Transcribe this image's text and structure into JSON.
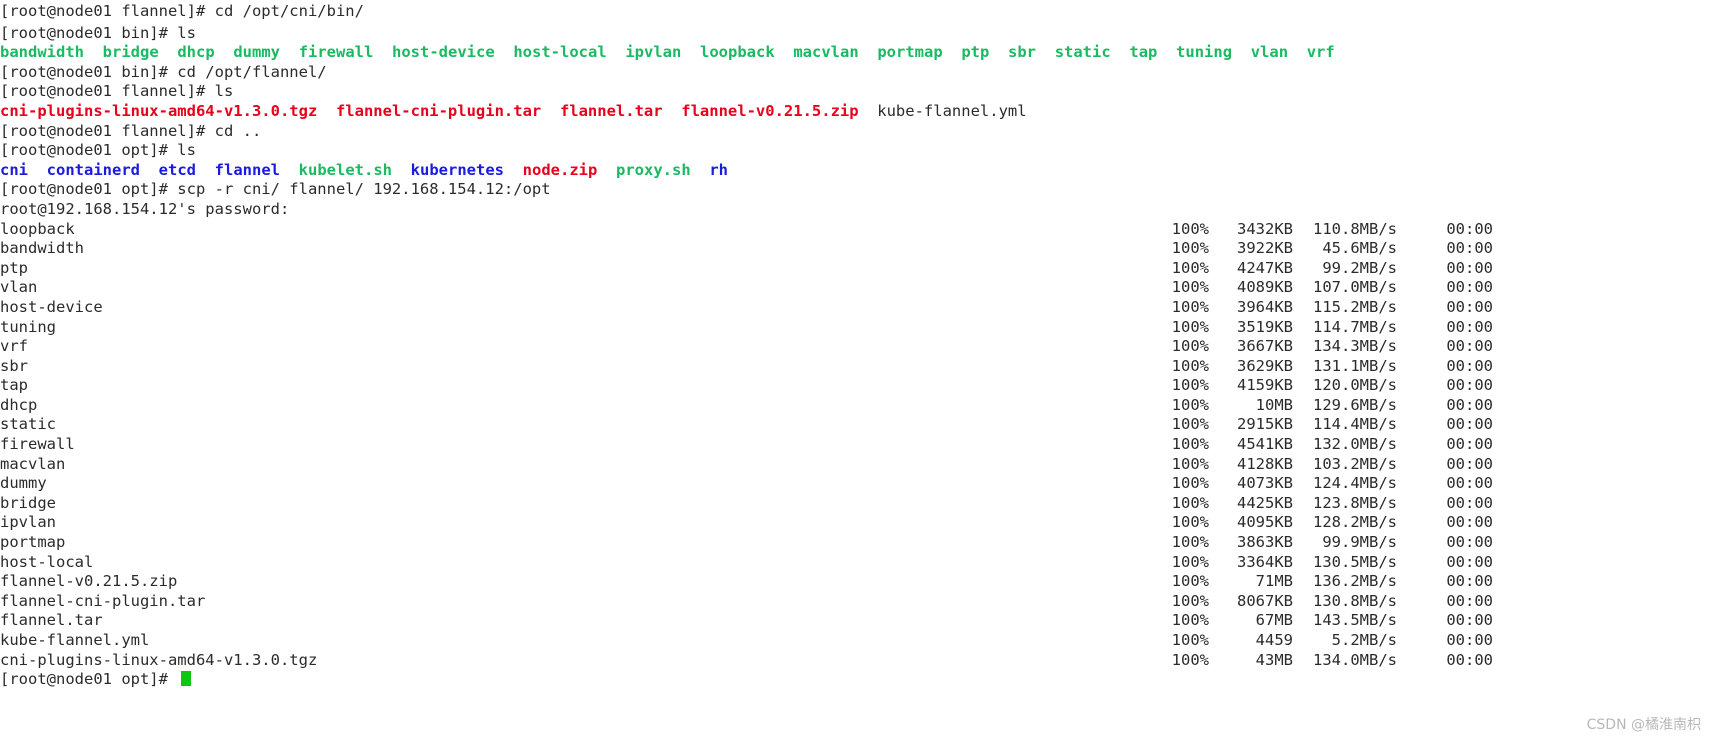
{
  "terminal": {
    "colors": {
      "background": "#ffffff",
      "default_text": "#2b2b2b",
      "directory_blue": "#1a1ae0",
      "executable_green": "#1aba61",
      "archive_red": "#e8001c",
      "cursor_green": "#12c512"
    },
    "prompts": {
      "p1": "[root@node01 flannel]# cd /opt/cni/bin/",
      "p2": "[root@node01 bin]# ls",
      "p3": "[root@node01 bin]# cd /opt/flannel/",
      "p4": "[root@node01 flannel]# ls",
      "p5": "[root@node01 flannel]# cd ..",
      "p6": "[root@node01 opt]# ls",
      "p7": "[root@node01 opt]# scp -r cni/ flannel/ 192.168.154.12:/opt",
      "p8": "root@192.168.154.12's password:",
      "p9": "[root@node01 opt]# "
    },
    "cni_bin_listing": [
      "bandwidth",
      "bridge",
      "dhcp",
      "dummy",
      "firewall",
      "host-device",
      "host-local",
      "ipvlan",
      "loopback",
      "macvlan",
      "portmap",
      "ptp",
      "sbr",
      "static",
      "tap",
      "tuning",
      "vlan",
      "vrf"
    ],
    "flannel_listing": [
      {
        "name": "cni-plugins-linux-amd64-v1.3.0.tgz",
        "color": "archive_red"
      },
      {
        "name": "flannel-cni-plugin.tar",
        "color": "archive_red"
      },
      {
        "name": "flannel.tar",
        "color": "archive_red"
      },
      {
        "name": "flannel-v0.21.5.zip",
        "color": "archive_red"
      },
      {
        "name": "kube-flannel.yml",
        "color": "default_text"
      }
    ],
    "opt_listing": [
      {
        "name": "cni",
        "color": "directory_blue"
      },
      {
        "name": "containerd",
        "color": "directory_blue"
      },
      {
        "name": "etcd",
        "color": "directory_blue"
      },
      {
        "name": "flannel",
        "color": "directory_blue"
      },
      {
        "name": "kubelet.sh",
        "color": "executable_green"
      },
      {
        "name": "kubernetes",
        "color": "directory_blue"
      },
      {
        "name": "node.zip",
        "color": "archive_red"
      },
      {
        "name": "proxy.sh",
        "color": "executable_green"
      },
      {
        "name": "rh",
        "color": "directory_blue"
      }
    ],
    "transfers": [
      {
        "name": "loopback",
        "percent": "100%",
        "size": "3432KB",
        "speed": "110.8MB/s",
        "time": "00:00"
      },
      {
        "name": "bandwidth",
        "percent": "100%",
        "size": "3922KB",
        "speed": "45.6MB/s",
        "time": "00:00"
      },
      {
        "name": "ptp",
        "percent": "100%",
        "size": "4247KB",
        "speed": "99.2MB/s",
        "time": "00:00"
      },
      {
        "name": "vlan",
        "percent": "100%",
        "size": "4089KB",
        "speed": "107.0MB/s",
        "time": "00:00"
      },
      {
        "name": "host-device",
        "percent": "100%",
        "size": "3964KB",
        "speed": "115.2MB/s",
        "time": "00:00"
      },
      {
        "name": "tuning",
        "percent": "100%",
        "size": "3519KB",
        "speed": "114.7MB/s",
        "time": "00:00"
      },
      {
        "name": "vrf",
        "percent": "100%",
        "size": "3667KB",
        "speed": "134.3MB/s",
        "time": "00:00"
      },
      {
        "name": "sbr",
        "percent": "100%",
        "size": "3629KB",
        "speed": "131.1MB/s",
        "time": "00:00"
      },
      {
        "name": "tap",
        "percent": "100%",
        "size": "4159KB",
        "speed": "120.0MB/s",
        "time": "00:00"
      },
      {
        "name": "dhcp",
        "percent": "100%",
        "size": "10MB",
        "speed": "129.6MB/s",
        "time": "00:00"
      },
      {
        "name": "static",
        "percent": "100%",
        "size": "2915KB",
        "speed": "114.4MB/s",
        "time": "00:00"
      },
      {
        "name": "firewall",
        "percent": "100%",
        "size": "4541KB",
        "speed": "132.0MB/s",
        "time": "00:00"
      },
      {
        "name": "macvlan",
        "percent": "100%",
        "size": "4128KB",
        "speed": "103.2MB/s",
        "time": "00:00"
      },
      {
        "name": "dummy",
        "percent": "100%",
        "size": "4073KB",
        "speed": "124.4MB/s",
        "time": "00:00"
      },
      {
        "name": "bridge",
        "percent": "100%",
        "size": "4425KB",
        "speed": "123.8MB/s",
        "time": "00:00"
      },
      {
        "name": "ipvlan",
        "percent": "100%",
        "size": "4095KB",
        "speed": "128.2MB/s",
        "time": "00:00"
      },
      {
        "name": "portmap",
        "percent": "100%",
        "size": "3863KB",
        "speed": "99.9MB/s",
        "time": "00:00"
      },
      {
        "name": "host-local",
        "percent": "100%",
        "size": "3364KB",
        "speed": "130.5MB/s",
        "time": "00:00"
      },
      {
        "name": "flannel-v0.21.5.zip",
        "percent": "100%",
        "size": "71MB",
        "speed": "136.2MB/s",
        "time": "00:00"
      },
      {
        "name": "flannel-cni-plugin.tar",
        "percent": "100%",
        "size": "8067KB",
        "speed": "130.8MB/s",
        "time": "00:00"
      },
      {
        "name": "flannel.tar",
        "percent": "100%",
        "size": "67MB",
        "speed": "143.5MB/s",
        "time": "00:00"
      },
      {
        "name": "kube-flannel.yml",
        "percent": "100%",
        "size": "4459",
        "speed": "5.2MB/s",
        "time": "00:00"
      },
      {
        "name": "cni-plugins-linux-amd64-v1.3.0.tgz",
        "percent": "100%",
        "size": "43MB",
        "speed": "134.0MB/s",
        "time": "00:00"
      }
    ]
  },
  "watermark": "CSDN @橘淮南枳"
}
